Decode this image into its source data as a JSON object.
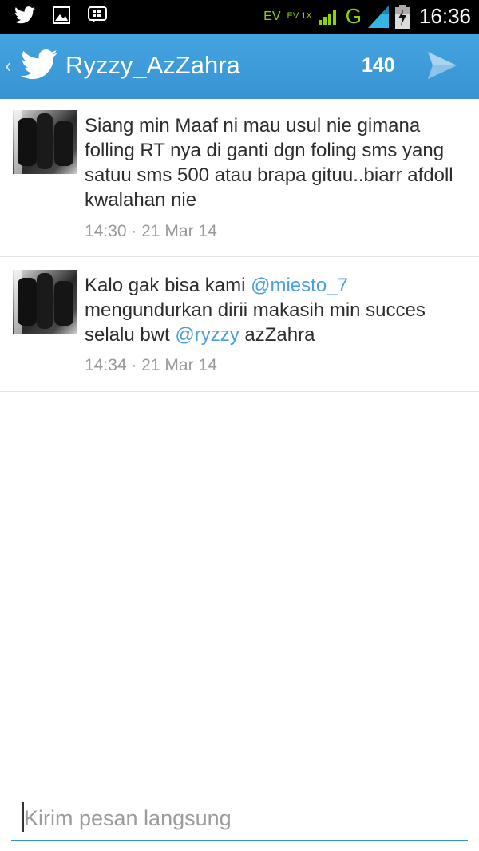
{
  "status_bar": {
    "network_labels": [
      "EV",
      "EV 1X",
      "G"
    ],
    "time": "16:36",
    "icons": [
      "twitter-icon",
      "image-icon",
      "bbm-icon",
      "signal-icon",
      "battery-icon"
    ]
  },
  "header": {
    "title": "Ryzzy_AzZahra",
    "char_count": "140"
  },
  "messages": [
    {
      "text": "Siang min Maaf ni mau usul nie gimana folling RT nya di ganti dgn foling sms yang satuu sms 500 atau brapa gituu..biarr afdoll kwalahan nie",
      "time": "14:30 · 21 Mar 14"
    },
    {
      "text_parts": [
        "Kalo gak bisa kami ",
        "@miesto_7",
        " mengundurkan dirii makasih min succes selalu bwt ",
        "@ryzzy",
        " azZahra"
      ],
      "time": "14:34 · 21 Mar 14"
    }
  ],
  "compose": {
    "placeholder": "Kirim pesan langsung"
  },
  "colors": {
    "accent": "#3993d3",
    "mention": "#4aa0dc",
    "status_green": "#8fd400"
  }
}
